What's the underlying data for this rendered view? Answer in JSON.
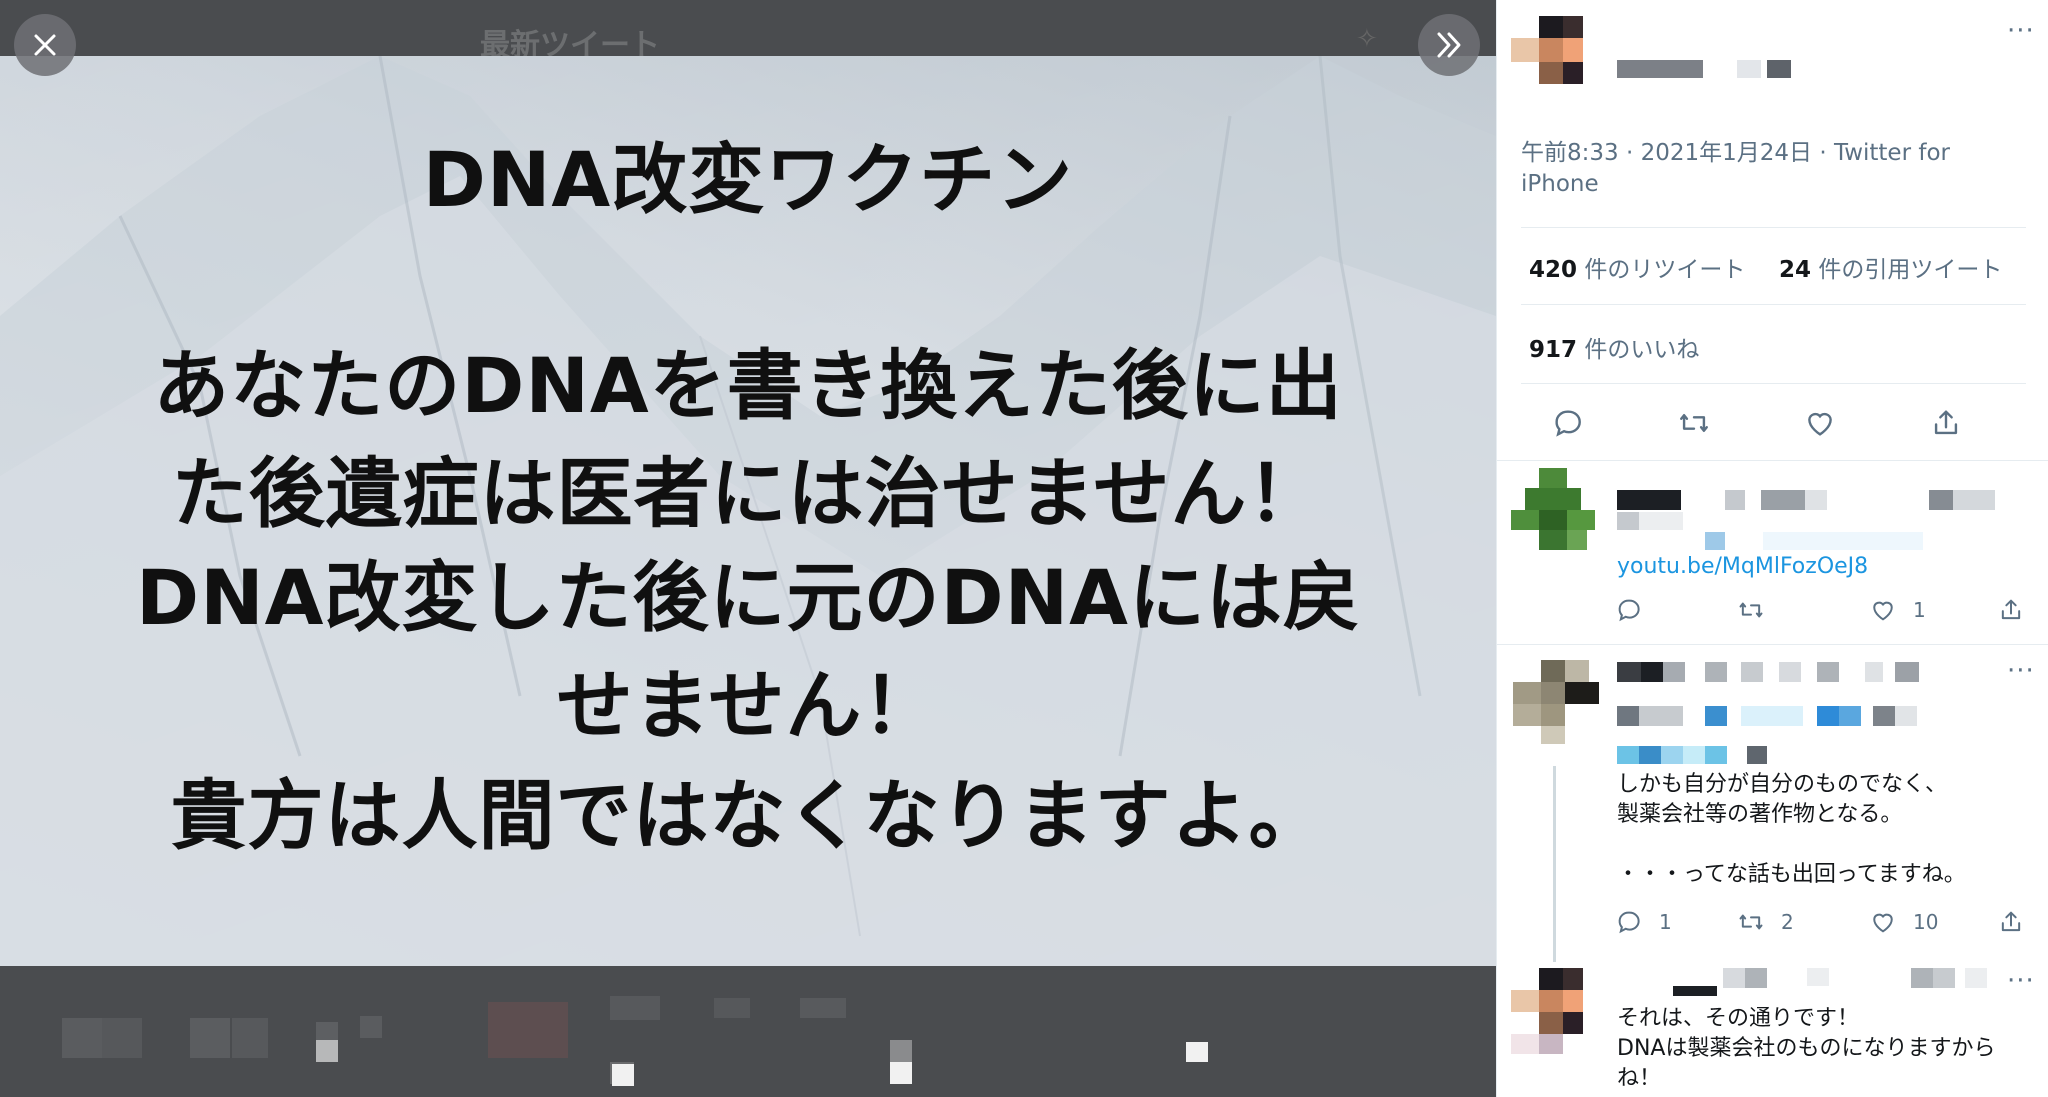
{
  "viewer": {
    "ghost_title": "最新ツイート",
    "image_text": {
      "title": "DNA改変ワクチン",
      "line1": "あなたのDNAを書き換えた後に出",
      "line2": "た後遺症は医者には治せません！",
      "line3": "DNA改変した後に元のDNAには戻",
      "line4": "せません！",
      "line5": "貴方は人間ではなくなりますよ。"
    }
  },
  "tweet": {
    "meta": "午前8:33 · 2021年1月24日 · Twitter for iPhone",
    "retweets_count": "420",
    "retweets_label": " 件のリツイート",
    "quotes_count": "24",
    "quotes_label": " 件の引用ツイート",
    "likes_count": "917",
    "likes_label": " 件のいいね",
    "more": "···"
  },
  "replies": [
    {
      "link": "youtu.be/MqMlFozOeJ8",
      "like_count": "1"
    },
    {
      "text_line1": "しかも自分が自分のものでなく、",
      "text_line2": "製薬会社等の著作物となる。",
      "text_line3": "・・・ってな話も出回ってますね。",
      "reply_count": "1",
      "retweet_count": "2",
      "like_count": "10"
    },
    {
      "text_line1": "それは、その通りです！",
      "text_line2": "DNAは製薬会社のものになりますから",
      "text_line3": "ね！"
    }
  ],
  "colors": {
    "viewer_bg": "#4a4c4f",
    "link": "#1b95e0",
    "secondary_text": "#5b7083"
  }
}
